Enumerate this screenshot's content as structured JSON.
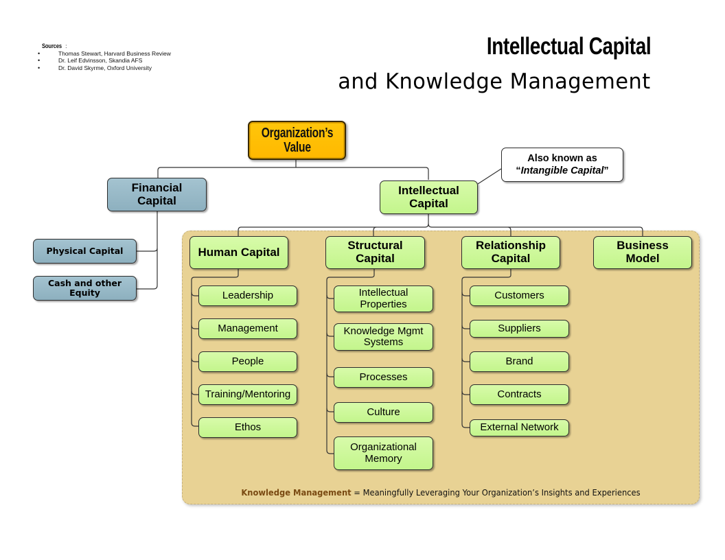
{
  "sources": {
    "heading": "Sources",
    "heading_suffix": ":",
    "items": [
      "Thomas Stewart, Harvard Business Review",
      "Dr. Leif Edvinsson, Skandia AFS",
      "Dr. David Skyrme, Oxford University"
    ]
  },
  "title": {
    "main": "Intellectual Capital",
    "sub": "and Knowledge Management"
  },
  "colors": {
    "root_fill": "#ffc000",
    "financial_fill": "#93b6c5",
    "intellectual_fill": "#ccf99a",
    "panel_fill": "#e8d294",
    "km_term": "#7a4a12",
    "connector": "#333333"
  },
  "diagram": {
    "root": {
      "line1": "Organization’s",
      "line2": "Value"
    },
    "financial": {
      "line1": "Financial",
      "line2": "Capital",
      "children": [
        "Physical Capital",
        "Cash and other Equity"
      ]
    },
    "intellectual": {
      "line1": "Intellectual",
      "line2": "Capital",
      "callout": {
        "line1": "Also known as",
        "quote_open": "“",
        "italic": "Intangible Capital",
        "quote_close": "”"
      },
      "branches": [
        {
          "line1": "Human Capital",
          "line2": "",
          "children": [
            {
              "line1": "Leadership",
              "line2": ""
            },
            {
              "line1": "Management",
              "line2": ""
            },
            {
              "line1": "People",
              "line2": ""
            },
            {
              "line1": "Training/Mentoring",
              "line2": ""
            },
            {
              "line1": "Ethos",
              "line2": ""
            }
          ]
        },
        {
          "line1": "Structural",
          "line2": "Capital",
          "children": [
            {
              "line1": "Intellectual",
              "line2": "Properties"
            },
            {
              "line1": "Knowledge Mgmt",
              "line2": "Systems"
            },
            {
              "line1": "Processes",
              "line2": ""
            },
            {
              "line1": "Culture",
              "line2": ""
            },
            {
              "line1": "Organizational",
              "line2": "Memory"
            }
          ]
        },
        {
          "line1": "Relationship",
          "line2": "Capital",
          "children": [
            {
              "line1": "Customers",
              "line2": ""
            },
            {
              "line1": "Suppliers",
              "line2": ""
            },
            {
              "line1": "Brand",
              "line2": ""
            },
            {
              "line1": "Contracts",
              "line2": ""
            },
            {
              "line1": "External Network",
              "line2": ""
            }
          ]
        },
        {
          "line1": "Business",
          "line2": "Model",
          "children": []
        }
      ]
    }
  },
  "footer": {
    "term": "Knowledge Management",
    "definition": " = Meaningfully Leveraging Your Organization’s Insights and Experiences"
  }
}
